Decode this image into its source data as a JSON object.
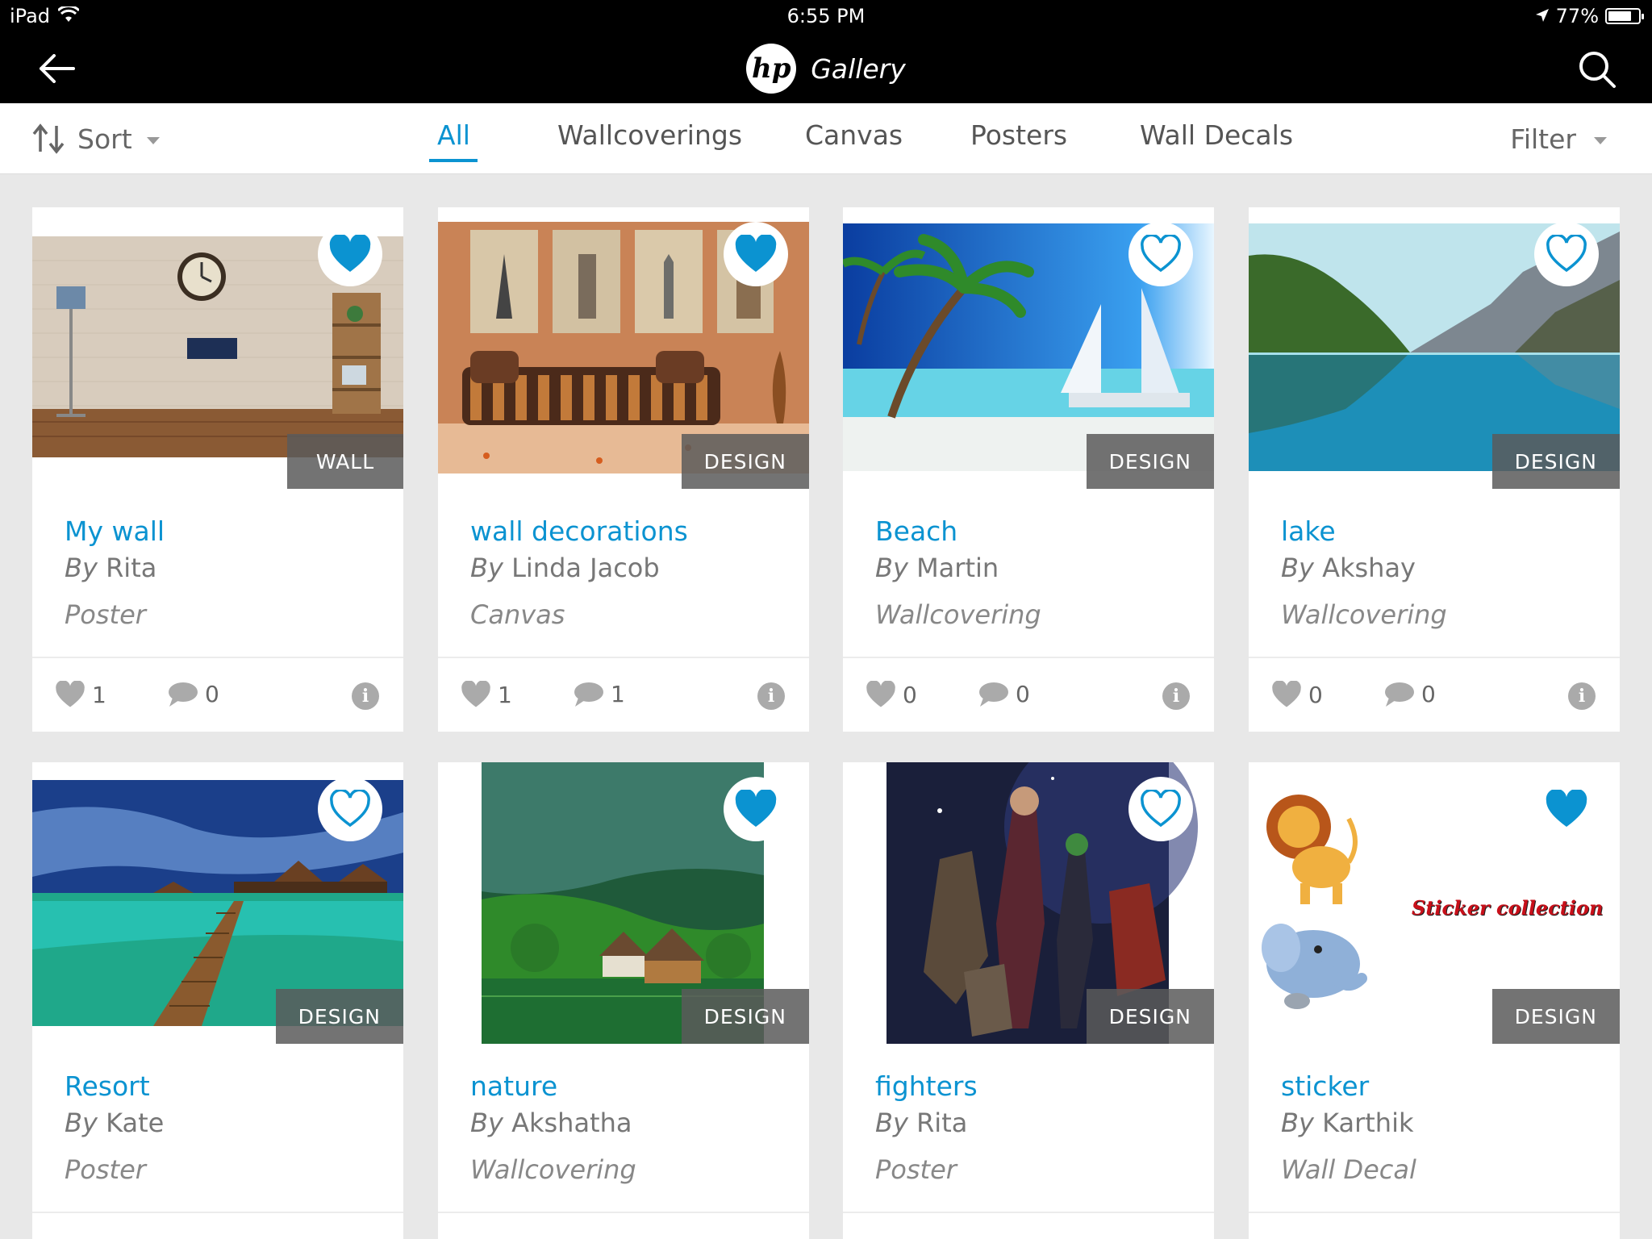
{
  "status_bar": {
    "device": "iPad",
    "time": "6:55 PM",
    "battery": "77%",
    "battery_level": 0.77
  },
  "nav": {
    "logo_text": "hp",
    "title": "Gallery",
    "back_icon": "arrow-left-icon",
    "search_icon": "search-icon"
  },
  "toolbar": {
    "sort_label": "Sort",
    "filter_label": "Filter",
    "tabs": [
      {
        "label": "All",
        "active": true
      },
      {
        "label": "Wallcoverings",
        "active": false
      },
      {
        "label": "Canvas",
        "active": false
      },
      {
        "label": "Posters",
        "active": false
      },
      {
        "label": "Wall Decals",
        "active": false
      }
    ]
  },
  "colors": {
    "accent": "#0b93d1",
    "nav_bg": "#000000",
    "page_bg": "#e8e8e8"
  },
  "cards": [
    {
      "title": "My wall",
      "by": "By",
      "author": "Rita",
      "type": "Poster",
      "tag": "WALL",
      "liked": true,
      "likes": "1",
      "comments": "0"
    },
    {
      "title": "wall decorations",
      "by": "By",
      "author": "Linda Jacob",
      "type": "Canvas",
      "tag": "DESIGN",
      "liked": true,
      "likes": "1",
      "comments": "1"
    },
    {
      "title": "Beach",
      "by": "By",
      "author": "Martin",
      "type": "Wallcovering",
      "tag": "DESIGN",
      "liked": false,
      "likes": "0",
      "comments": "0"
    },
    {
      "title": "lake",
      "by": "By",
      "author": "Akshay",
      "type": "Wallcovering",
      "tag": "DESIGN",
      "liked": false,
      "likes": "0",
      "comments": "0"
    },
    {
      "title": "Resort",
      "by": "By",
      "author": "Kate",
      "type": "Poster",
      "tag": "DESIGN",
      "liked": false
    },
    {
      "title": "nature",
      "by": "By",
      "author": "Akshatha",
      "type": "Wallcovering",
      "tag": "DESIGN",
      "liked": true
    },
    {
      "title": "fighters",
      "by": "By",
      "author": "Rita",
      "type": "Poster",
      "tag": "DESIGN",
      "liked": false
    },
    {
      "title": "sticker",
      "by": "By",
      "author": "Karthik",
      "type": "Wall Decal",
      "tag": "DESIGN",
      "liked": true,
      "sticker_text": "Sticker collection"
    }
  ]
}
